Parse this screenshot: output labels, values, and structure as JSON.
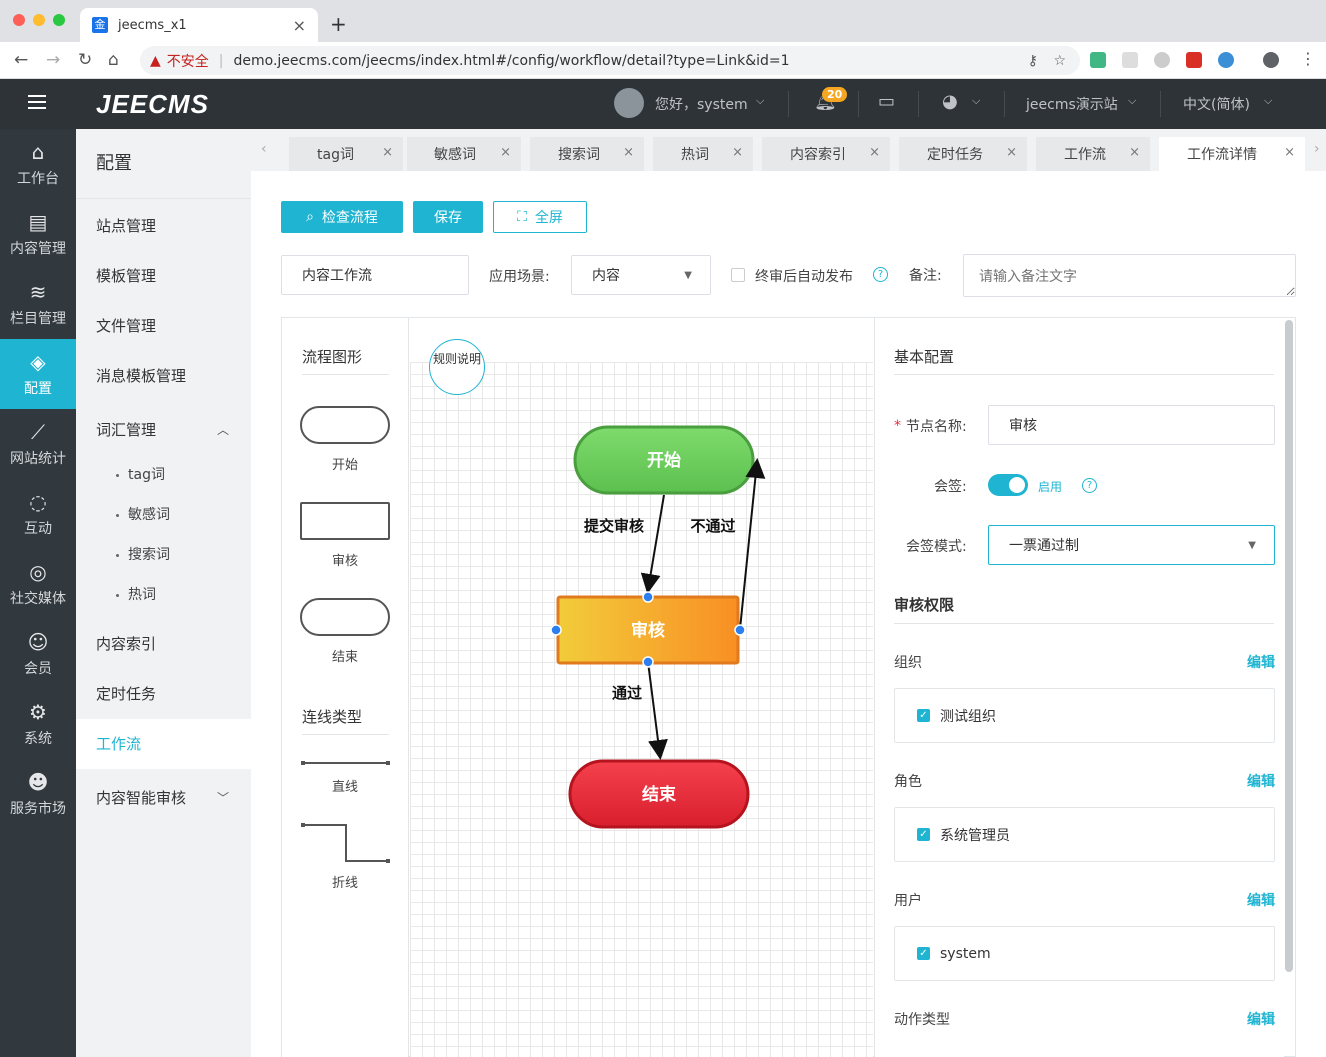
{
  "browser": {
    "tab_title": "jeecms_x1",
    "tab_favicon": "金",
    "insecure_label": "不安全",
    "url": "demo.jeecms.com/jeecms/index.html#/config/workflow/detail?type=Link&id=1"
  },
  "header": {
    "logo": "JEECMS",
    "greeting": "您好，system",
    "notif_count": "20",
    "site": "jeecms演示站",
    "language": "中文(简体)"
  },
  "sidebar": {
    "items": [
      {
        "label": "工作台",
        "icon": "home-icon"
      },
      {
        "label": "内容管理",
        "icon": "document-icon"
      },
      {
        "label": "栏目管理",
        "icon": "layers-icon"
      },
      {
        "label": "配置",
        "icon": "box-icon",
        "active": true
      },
      {
        "label": "网站统计",
        "icon": "chart-icon"
      },
      {
        "label": "互动",
        "icon": "chat-icon"
      },
      {
        "label": "社交媒体",
        "icon": "social-icon"
      },
      {
        "label": "会员",
        "icon": "member-icon"
      },
      {
        "label": "系统",
        "icon": "gear-icon"
      },
      {
        "label": "服务市场",
        "icon": "service-icon"
      }
    ]
  },
  "submenu": {
    "title": "配置",
    "items": [
      "站点管理",
      "模板管理",
      "文件管理",
      "消息模板管理",
      "词汇管理"
    ],
    "vocab_children": [
      "tag词",
      "敏感词",
      "搜索词",
      "热词"
    ],
    "after": [
      "内容索引",
      "定时任务",
      "工作流",
      "内容智能审核"
    ]
  },
  "tabs": [
    "tag词",
    "敏感词",
    "搜索词",
    "热词",
    "内容索引",
    "定时任务",
    "工作流",
    "工作流详情"
  ],
  "toolbar": {
    "check": "检查流程",
    "save": "保存",
    "fullscreen": "全屏"
  },
  "form": {
    "name": "内容工作流",
    "scene_label": "应用场景:",
    "scene_value": "内容",
    "auto_publish": "终审后自动发布",
    "remark_label": "备注:",
    "remark_placeholder": "请输入备注文字"
  },
  "palette": {
    "shapes_title": "流程图形",
    "shapes": [
      "开始",
      "审核",
      "结束"
    ],
    "lines_title": "连线类型",
    "lines": [
      "直线",
      "折线"
    ]
  },
  "canvas": {
    "rule": "规则说明",
    "nodes": {
      "start": "开始",
      "review": "审核",
      "end": "结束"
    },
    "edges": {
      "submit": "提交审核",
      "reject": "不通过",
      "pass": "通过"
    }
  },
  "props": {
    "basic_title": "基本配置",
    "node_name_label": "节点名称:",
    "node_name_value": "审核",
    "countersign_label": "会签:",
    "countersign_state": "启用",
    "countersign_mode_label": "会签模式:",
    "countersign_mode_value": "一票通过制",
    "perm_title": "审核权限",
    "edit": "编辑",
    "groups": [
      {
        "label": "组织",
        "value": "测试组织"
      },
      {
        "label": "角色",
        "value": "系统管理员"
      },
      {
        "label": "用户",
        "value": "system"
      }
    ],
    "action_label": "动作类型"
  },
  "colors": {
    "accent": "#1fb5d2",
    "start": "#6fd160",
    "review": "#f7a233",
    "end": "#e5313d"
  }
}
